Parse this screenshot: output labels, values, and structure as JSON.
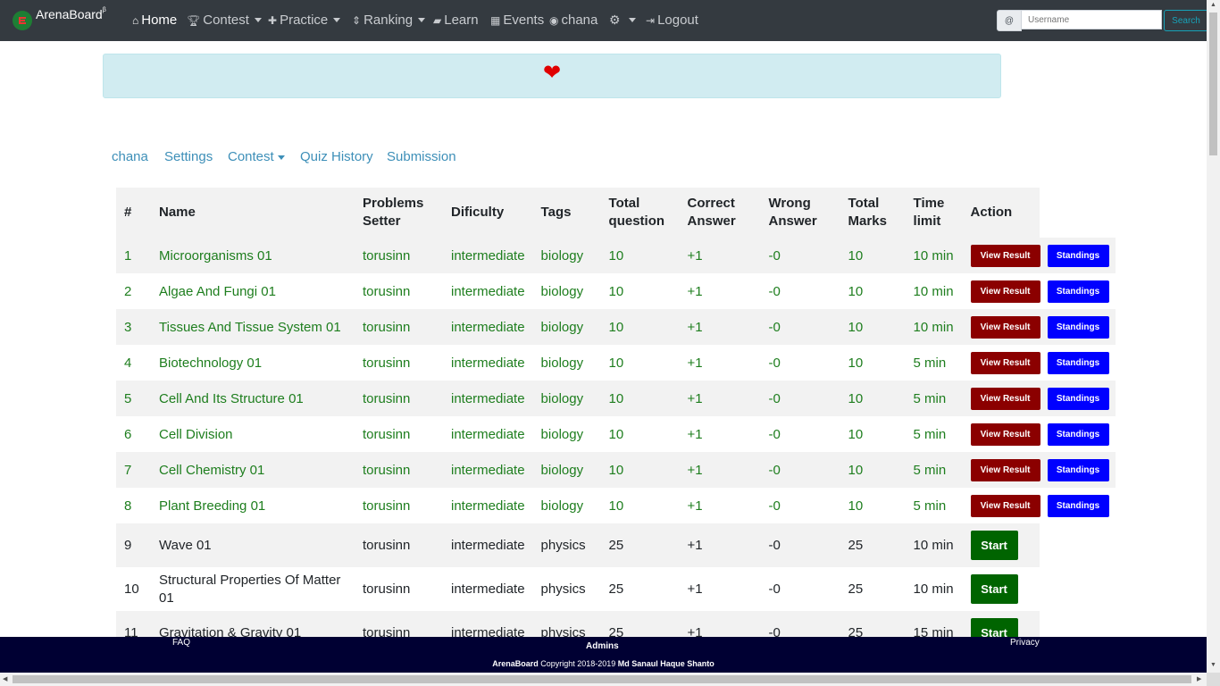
{
  "nav": {
    "brand": "ArenaBoard",
    "brand_sup": "β",
    "home": "Home",
    "contest": "Contest",
    "practice": "Practice",
    "ranking": "Ranking",
    "learn": "Learn",
    "events": "Events",
    "user": "chana",
    "logout": "Logout",
    "search_prefix": "@",
    "search_placeholder": "Username",
    "search_button": "Search"
  },
  "alert": {
    "icon": "heart-icon",
    "color": "#e00000"
  },
  "subnav": {
    "user": "chana",
    "settings": "Settings",
    "contest": "Contest",
    "quiz_history": "Quiz History",
    "submission": "Submission"
  },
  "table": {
    "headers": {
      "num": "#",
      "name": "Name",
      "setter_1": "Problems",
      "setter_2": "Setter",
      "difficulty": "Dificulty",
      "tags": "Tags",
      "total_q_1": "Total",
      "total_q_2": "question",
      "correct_1": "Correct",
      "correct_2": "Answer",
      "wrong_1": "Wrong",
      "wrong_2": "Answer",
      "marks_1": "Total",
      "marks_2": "Marks",
      "time_1": "Time",
      "time_2": "limit",
      "action": "Action"
    },
    "rows": [
      {
        "num": "1",
        "name": "Microorganisms 01",
        "setter": "torusinn",
        "difficulty": "intermediate",
        "tags": "biology",
        "total": "10",
        "correct": "+1",
        "wrong": "-0",
        "marks": "10",
        "time": "10 min",
        "status": "done",
        "view": "View Result",
        "standings": "Standings"
      },
      {
        "num": "2",
        "name": "Algae And Fungi 01",
        "setter": "torusinn",
        "difficulty": "intermediate",
        "tags": "biology",
        "total": "10",
        "correct": "+1",
        "wrong": "-0",
        "marks": "10",
        "time": "10 min",
        "status": "done",
        "view": "View Result",
        "standings": "Standings"
      },
      {
        "num": "3",
        "name": "Tissues And Tissue System 01",
        "setter": "torusinn",
        "difficulty": "intermediate",
        "tags": "biology",
        "total": "10",
        "correct": "+1",
        "wrong": "-0",
        "marks": "10",
        "time": "10 min",
        "status": "done",
        "view": "View Result",
        "standings": "Standings"
      },
      {
        "num": "4",
        "name": "Biotechnology 01",
        "setter": "torusinn",
        "difficulty": "intermediate",
        "tags": "biology",
        "total": "10",
        "correct": "+1",
        "wrong": "-0",
        "marks": "10",
        "time": "5 min",
        "status": "done",
        "view": "View Result",
        "standings": "Standings"
      },
      {
        "num": "5",
        "name": "Cell And Its Structure 01",
        "setter": "torusinn",
        "difficulty": "intermediate",
        "tags": "biology",
        "total": "10",
        "correct": "+1",
        "wrong": "-0",
        "marks": "10",
        "time": "5 min",
        "status": "done",
        "view": "View Result",
        "standings": "Standings"
      },
      {
        "num": "6",
        "name": "Cell Division",
        "setter": "torusinn",
        "difficulty": "intermediate",
        "tags": "biology",
        "total": "10",
        "correct": "+1",
        "wrong": "-0",
        "marks": "10",
        "time": "5 min",
        "status": "done",
        "view": "View Result",
        "standings": "Standings"
      },
      {
        "num": "7",
        "name": "Cell Chemistry 01",
        "setter": "torusinn",
        "difficulty": "intermediate",
        "tags": "biology",
        "total": "10",
        "correct": "+1",
        "wrong": "-0",
        "marks": "10",
        "time": "5 min",
        "status": "done",
        "view": "View Result",
        "standings": "Standings"
      },
      {
        "num": "8",
        "name": "Plant Breeding 01",
        "setter": "torusinn",
        "difficulty": "intermediate",
        "tags": "biology",
        "total": "10",
        "correct": "+1",
        "wrong": "-0",
        "marks": "10",
        "time": "5 min",
        "status": "done",
        "view": "View Result",
        "standings": "Standings"
      },
      {
        "num": "9",
        "name": "Wave 01",
        "setter": "torusinn",
        "difficulty": "intermediate",
        "tags": "physics",
        "total": "25",
        "correct": "+1",
        "wrong": "-0",
        "marks": "25",
        "time": "10 min",
        "status": "todo",
        "start": "Start"
      },
      {
        "num": "10",
        "name": "Structural Properties Of Matter 01",
        "setter": "torusinn",
        "difficulty": "intermediate",
        "tags": "physics",
        "total": "25",
        "correct": "+1",
        "wrong": "-0",
        "marks": "25",
        "time": "10 min",
        "status": "todo",
        "start": "Start"
      },
      {
        "num": "11",
        "name": "Gravitation & Gravity 01",
        "setter": "torusinn",
        "difficulty": "intermediate",
        "tags": "physics",
        "total": "25",
        "correct": "+1",
        "wrong": "-0",
        "marks": "25",
        "time": "15 min",
        "status": "todo",
        "start": "Start"
      }
    ]
  },
  "footer": {
    "faq": "FAQ",
    "admins": "Admins",
    "privacy": "Privacy",
    "brand": "ArenaBoard",
    "copyright": " Copyright 2018-2019 ",
    "author": "Md Sanaul Haque Shanto"
  }
}
